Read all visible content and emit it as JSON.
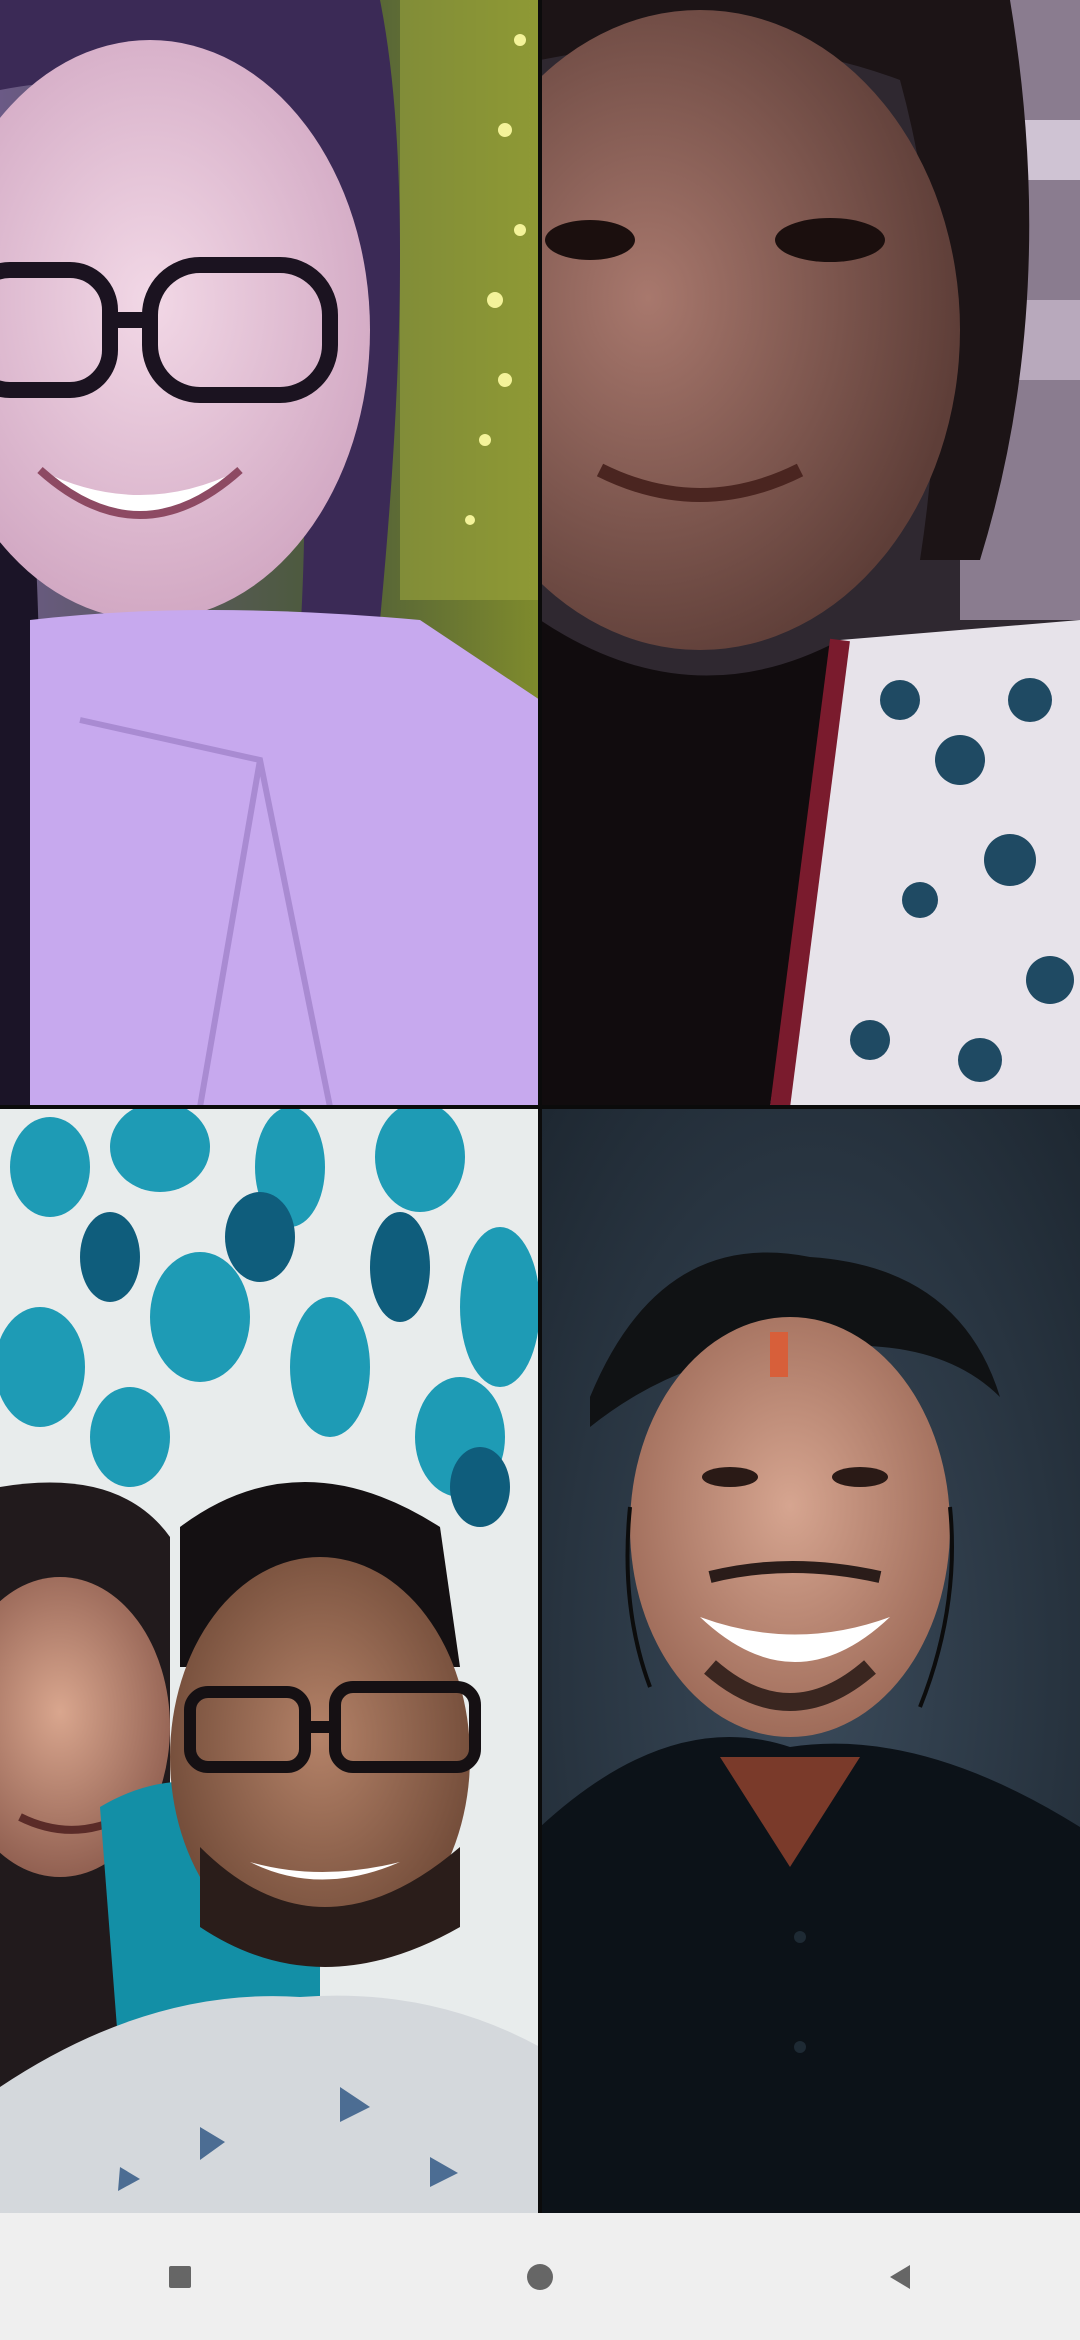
{
  "call": {
    "tiles": [
      {
        "id": "participant-1"
      },
      {
        "id": "participant-2"
      },
      {
        "id": "participant-3"
      },
      {
        "id": "participant-4"
      }
    ]
  },
  "navbar": {
    "buttons": [
      {
        "icon": "square-icon"
      },
      {
        "icon": "circle-icon"
      },
      {
        "icon": "back-triangle-icon"
      }
    ]
  }
}
